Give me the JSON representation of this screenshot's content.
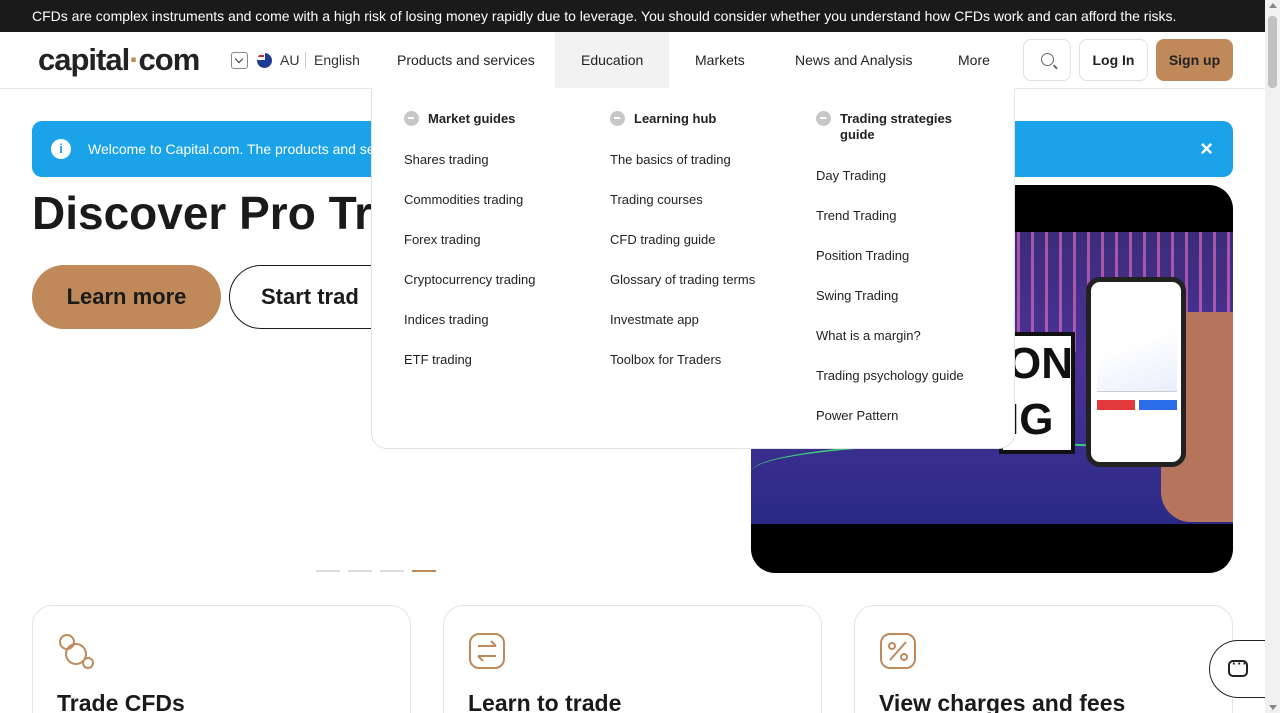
{
  "risk_warning": "CFDs are complex instruments and come with a high risk of losing money rapidly due to leverage. You should consider whether you understand how CFDs work and can afford the risks.",
  "header": {
    "logo_main": "capital",
    "logo_dot": "·",
    "logo_suffix": "com",
    "region": "AU",
    "language": "English",
    "nav": {
      "products": "Products and services",
      "education": "Education",
      "markets": "Markets",
      "news": "News and Analysis",
      "more": "More"
    },
    "login": "Log In",
    "signup": "Sign up"
  },
  "banner": {
    "text": "Welcome to Capital.com. The products and serv",
    "close": "×"
  },
  "hero": {
    "title": "Discover Pro Tra",
    "learn_more": "Learn more",
    "start_trading": "Start trad",
    "image_text": "ON IG",
    "active_slide": 4,
    "total_slides": 4
  },
  "dropdown": {
    "market_guides": {
      "heading": "Market guides",
      "items": [
        "Shares trading",
        "Commodities trading",
        "Forex trading",
        "Cryptocurrency trading",
        "Indices trading",
        "ETF trading"
      ]
    },
    "learning_hub": {
      "heading": "Learning hub",
      "items": [
        "The basics of trading",
        "Trading courses",
        "CFD trading guide",
        "Glossary of trading terms",
        "Investmate app",
        "Toolbox for Traders"
      ]
    },
    "strategies": {
      "heading_line1": "Trading strategies",
      "heading_line2": "guide",
      "items": [
        "Day Trading",
        "Trend Trading",
        "Position Trading",
        "Swing Trading",
        "What is a margin?",
        "Trading psychology guide",
        "Power Pattern"
      ]
    }
  },
  "features": {
    "trade_cfds": "Trade CFDs",
    "learn": "Learn to trade",
    "charges": "View charges and fees"
  },
  "icons": {
    "search": "search-icon",
    "info": "info-icon",
    "chat": "chat-icon",
    "accent": "#c0895a",
    "banner_color": "#1aa3e8"
  }
}
